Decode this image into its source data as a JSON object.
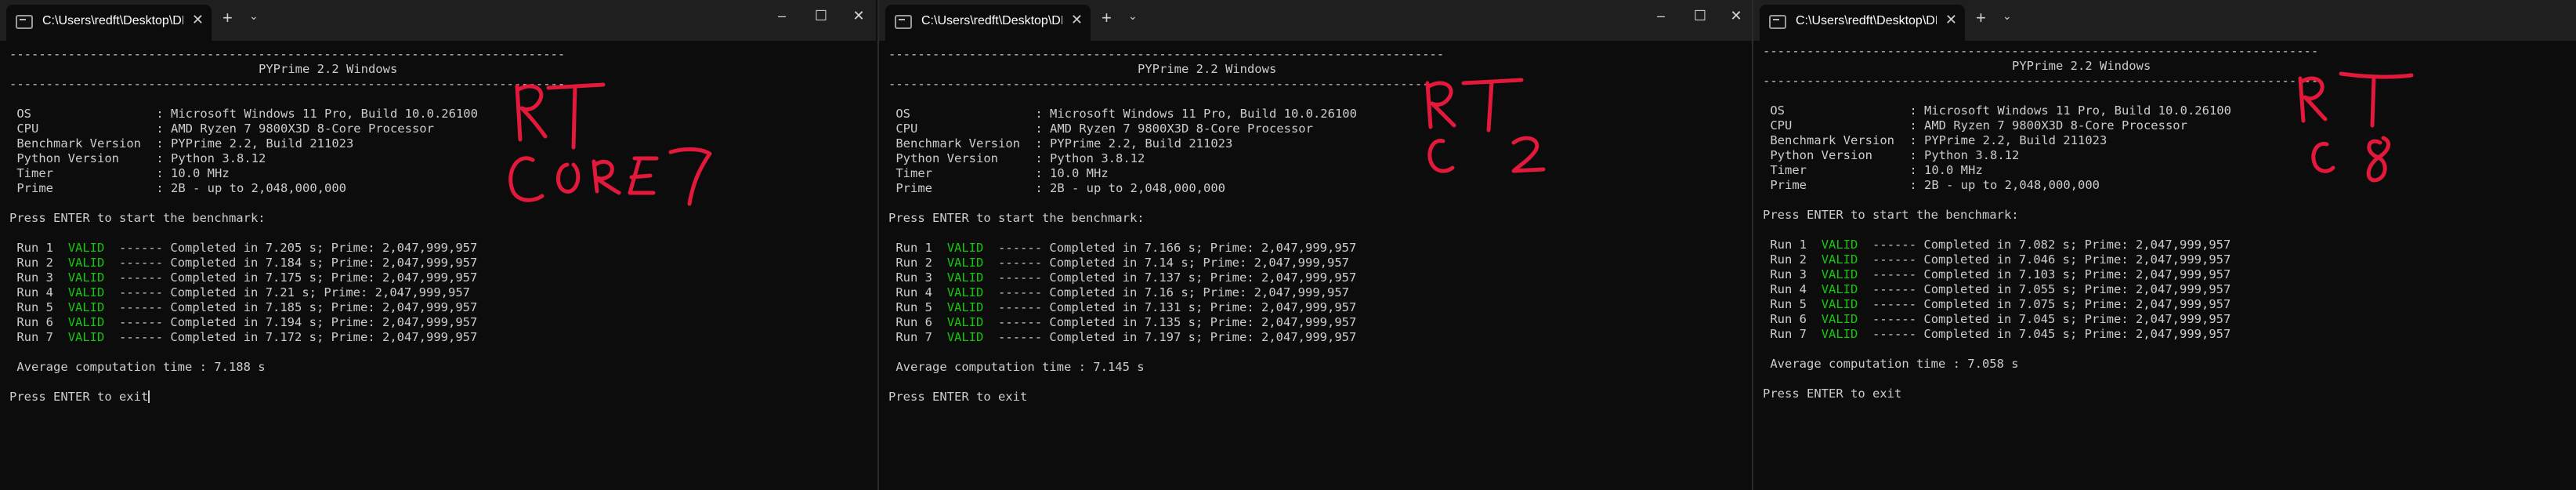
{
  "windows": [
    {
      "tab_title": "C:\\Users\\redft\\Desktop\\DRAK",
      "separator": "----------------------------------------------------------------------------",
      "heading": "PYPrime 2.2 Windows",
      "info": [
        {
          "label": "OS",
          "value": "Microsoft Windows 11 Pro, Build 10.0.26100"
        },
        {
          "label": "CPU",
          "value": "AMD Ryzen 7 9800X3D 8-Core Processor"
        },
        {
          "label": "Benchmark Version",
          "value": "PYPrime 2.2, Build 211023"
        },
        {
          "label": "Python Version",
          "value": "Python 3.8.12"
        },
        {
          "label": "Timer",
          "value": "10.0 MHz"
        },
        {
          "label": "Prime",
          "value": "2B - up to 2,048,000,000"
        }
      ],
      "prompt_start": "Press ENTER to start the benchmark:",
      "runs": [
        {
          "run": "Run 1",
          "status": "VALID",
          "dashes": "------",
          "text": "Completed in 7.205 s; Prime: 2,047,999,957"
        },
        {
          "run": "Run 2",
          "status": "VALID",
          "dashes": "------",
          "text": "Completed in 7.184 s; Prime: 2,047,999,957"
        },
        {
          "run": "Run 3",
          "status": "VALID",
          "dashes": "------",
          "text": "Completed in 7.175 s; Prime: 2,047,999,957"
        },
        {
          "run": "Run 4",
          "status": "VALID",
          "dashes": "------",
          "text": "Completed in 7.21 s; Prime: 2,047,999,957"
        },
        {
          "run": "Run 5",
          "status": "VALID",
          "dashes": "------",
          "text": "Completed in 7.185 s; Prime: 2,047,999,957"
        },
        {
          "run": "Run 6",
          "status": "VALID",
          "dashes": "------",
          "text": "Completed in 7.194 s; Prime: 2,047,999,957"
        },
        {
          "run": "Run 7",
          "status": "VALID",
          "dashes": "------",
          "text": "Completed in 7.172 s; Prime: 2,047,999,957"
        }
      ],
      "average": "Average computation time : 7.188 s",
      "prompt_exit": "Press ENTER to exit"
    },
    {
      "tab_title": "C:\\Users\\redft\\Desktop\\DRAK",
      "separator": "----------------------------------------------------------------------------",
      "heading": "PYPrime 2.2 Windows",
      "info": [
        {
          "label": "OS",
          "value": "Microsoft Windows 11 Pro, Build 10.0.26100"
        },
        {
          "label": "CPU",
          "value": "AMD Ryzen 7 9800X3D 8-Core Processor"
        },
        {
          "label": "Benchmark Version",
          "value": "PYPrime 2.2, Build 211023"
        },
        {
          "label": "Python Version",
          "value": "Python 3.8.12"
        },
        {
          "label": "Timer",
          "value": "10.0 MHz"
        },
        {
          "label": "Prime",
          "value": "2B - up to 2,048,000,000"
        }
      ],
      "prompt_start": "Press ENTER to start the benchmark:",
      "runs": [
        {
          "run": "Run 1",
          "status": "VALID",
          "dashes": "------",
          "text": "Completed in 7.166 s; Prime: 2,047,999,957"
        },
        {
          "run": "Run 2",
          "status": "VALID",
          "dashes": "------",
          "text": "Completed in 7.14 s; Prime: 2,047,999,957"
        },
        {
          "run": "Run 3",
          "status": "VALID",
          "dashes": "------",
          "text": "Completed in 7.137 s; Prime: 2,047,999,957"
        },
        {
          "run": "Run 4",
          "status": "VALID",
          "dashes": "------",
          "text": "Completed in 7.16 s; Prime: 2,047,999,957"
        },
        {
          "run": "Run 5",
          "status": "VALID",
          "dashes": "------",
          "text": "Completed in 7.131 s; Prime: 2,047,999,957"
        },
        {
          "run": "Run 6",
          "status": "VALID",
          "dashes": "------",
          "text": "Completed in 7.135 s; Prime: 2,047,999,957"
        },
        {
          "run": "Run 7",
          "status": "VALID",
          "dashes": "------",
          "text": "Completed in 7.197 s; Prime: 2,047,999,957"
        }
      ],
      "average": "Average computation time : 7.145 s",
      "prompt_exit": "Press ENTER to exit"
    },
    {
      "tab_title": "C:\\Users\\redft\\Desktop\\DRAK",
      "separator": "----------------------------------------------------------------------------",
      "heading": "PYPrime 2.2 Windows",
      "info": [
        {
          "label": "OS",
          "value": "Microsoft Windows 11 Pro, Build 10.0.26100"
        },
        {
          "label": "CPU",
          "value": "AMD Ryzen 7 9800X3D 8-Core Processor"
        },
        {
          "label": "Benchmark Version",
          "value": "PYPrime 2.2, Build 211023"
        },
        {
          "label": "Python Version",
          "value": "Python 3.8.12"
        },
        {
          "label": "Timer",
          "value": "10.0 MHz"
        },
        {
          "label": "Prime",
          "value": "2B - up to 2,048,000,000"
        }
      ],
      "prompt_start": "Press ENTER to start the benchmark:",
      "runs": [
        {
          "run": "Run 1",
          "status": "VALID",
          "dashes": "------",
          "text": "Completed in 7.082 s; Prime: 2,047,999,957"
        },
        {
          "run": "Run 2",
          "status": "VALID",
          "dashes": "------",
          "text": "Completed in 7.046 s; Prime: 2,047,999,957"
        },
        {
          "run": "Run 3",
          "status": "VALID",
          "dashes": "------",
          "text": "Completed in 7.103 s; Prime: 2,047,999,957"
        },
        {
          "run": "Run 4",
          "status": "VALID",
          "dashes": "------",
          "text": "Completed in 7.055 s; Prime: 2,047,999,957"
        },
        {
          "run": "Run 5",
          "status": "VALID",
          "dashes": "------",
          "text": "Completed in 7.075 s; Prime: 2,047,999,957"
        },
        {
          "run": "Run 6",
          "status": "VALID",
          "dashes": "------",
          "text": "Completed in 7.045 s; Prime: 2,047,999,957"
        },
        {
          "run": "Run 7",
          "status": "VALID",
          "dashes": "------",
          "text": "Completed in 7.045 s; Prime: 2,047,999,957"
        }
      ],
      "average": "Average computation time : 7.058 s",
      "prompt_exit": "Press ENTER to exit"
    }
  ],
  "icons": {
    "terminal": "terminal-icon",
    "close_tab": "close-icon",
    "new_tab": "plus-icon",
    "dropdown": "chevron-down-icon",
    "minimize": "minimize-icon",
    "maximize": "maximize-icon",
    "close_window": "close-icon"
  },
  "colors": {
    "background": "#0c0c0c",
    "titlebar": "#1f1f1f",
    "text": "#cccccc",
    "valid": "#16c60c",
    "annotation": "#e3193b"
  }
}
